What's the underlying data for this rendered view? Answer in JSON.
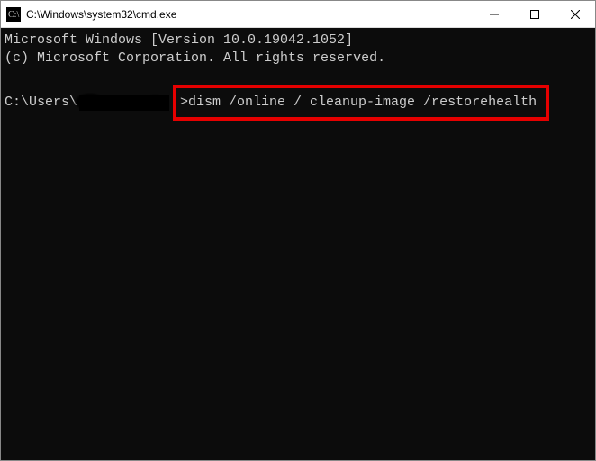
{
  "titlebar": {
    "path": "C:\\Windows\\system32\\cmd.exe"
  },
  "terminal": {
    "line1": "Microsoft Windows [Version 10.0.19042.1052]",
    "line2": "(c) Microsoft Corporation. All rights reserved.",
    "prompt_prefix": "C:\\Users\\",
    "command": ">dism /online / cleanup-image /restorehealth"
  },
  "highlight": {
    "border_color": "#e60000"
  }
}
